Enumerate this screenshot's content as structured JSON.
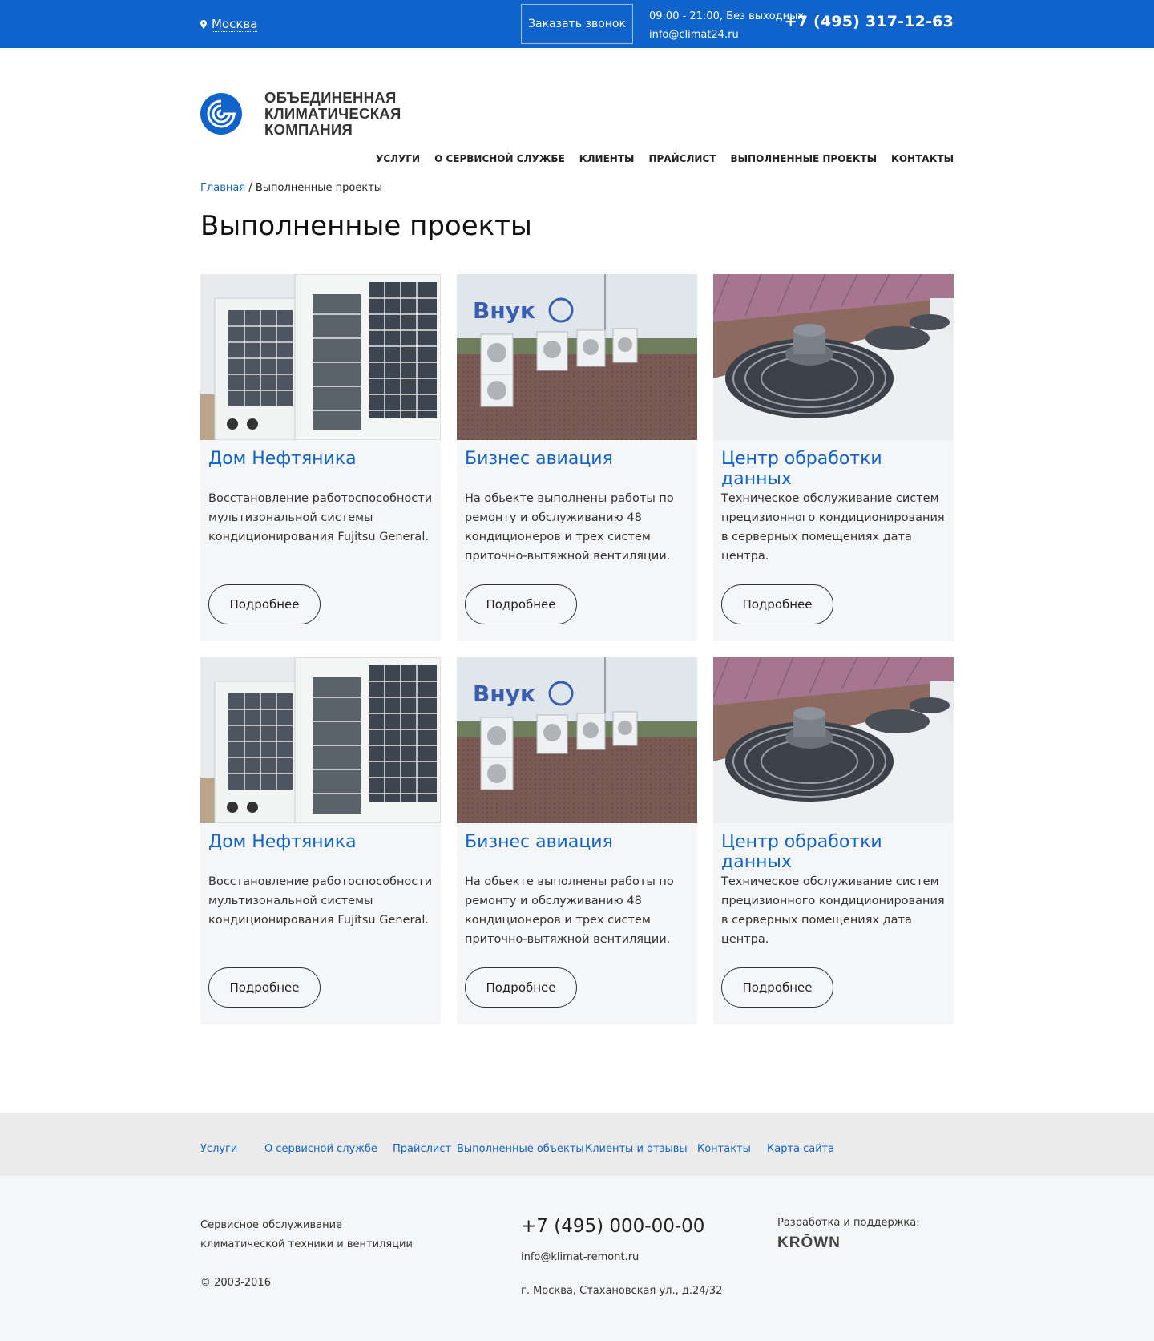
{
  "topbar": {
    "city": "Москва",
    "callback_label": "Заказать звонок",
    "hours": "09:00 - 21:00, Без выходных",
    "email": "info@climat24.ru",
    "phone": "+7 (495) 317-12-63"
  },
  "header": {
    "logo_line1": "ОБЪЕДИНЕННАЯ",
    "logo_line2": "КЛИМАТИЧЕСКАЯ",
    "logo_line3": "КОМПАНИЯ",
    "nav": [
      "УСЛУГИ",
      "О СЕРВИСНОЙ СЛУЖБЕ",
      "КЛИЕНТЫ",
      "ПРАЙСЛИСТ",
      "ВЫПОЛНЕННЫЕ ПРОЕКТЫ",
      "КОНТАКТЫ"
    ]
  },
  "breadcrumb": {
    "home": "Главная",
    "separator": " / ",
    "current": "Выполненные проекты"
  },
  "page_title": "Выполненные проекты",
  "cards": [
    {
      "title": "Дом Нефтяника",
      "text": "Восстановление работоспособности мультизональной системы кондиционирования Fujitsu General.",
      "button": "Подробнее",
      "image": "condenser-units-photo"
    },
    {
      "title": "Бизнес авиация",
      "text": "На обьекте выполнены работы по ремонту и обслуживанию 48 кондиционеров и трех систем приточно-вытяжной вентиляции.",
      "button": "Подробнее",
      "image": "rooftop-ac-units-photo"
    },
    {
      "title": "Центр обработки данных",
      "text": "Техническое обслуживание систем прецизионного кондиционирования в серверных помещениях дата центра.",
      "button": "Подробнее",
      "image": "rooftop-fans-photo"
    },
    {
      "title": "Дом Нефтяника",
      "text": "Восстановление работоспособности мультизональной системы кондиционирования Fujitsu General.",
      "button": "Подробнее",
      "image": "condenser-units-photo"
    },
    {
      "title": "Бизнес авиация",
      "text": "На обьекте выполнены работы по ремонту и обслуживанию 48 кондиционеров и трех систем приточно-вытяжной вентиляции.",
      "button": "Подробнее",
      "image": "rooftop-ac-units-photo"
    },
    {
      "title": "Центр обработки данных",
      "text": "Техническое обслуживание систем прецизионного кондиционирования в серверных помещениях дата центра.",
      "button": "Подробнее",
      "image": "rooftop-fans-photo"
    }
  ],
  "footer_nav": [
    "Услуги",
    "О сервисной службе",
    "Прайслист",
    "Выполненные объекты",
    "Клиенты и отзывы",
    "Контакты",
    "Карта сайта"
  ],
  "footer": {
    "description": "Сервисное обслуживание климатической техники и вентиляции",
    "copyright": "© 2003-2016",
    "phone": "+7 (495) 000-00-00",
    "email": "info@klimat-remont.ru",
    "address": "г. Москва, Стахановская ул., д.24/32",
    "dev_label": "Разработка и поддержка:",
    "dev_logo": "KRŌWN"
  },
  "colors": {
    "brand_blue": "#0f63cb",
    "card_bg": "#f5f6f8",
    "footer_nav_bg": "#ebebeb"
  }
}
